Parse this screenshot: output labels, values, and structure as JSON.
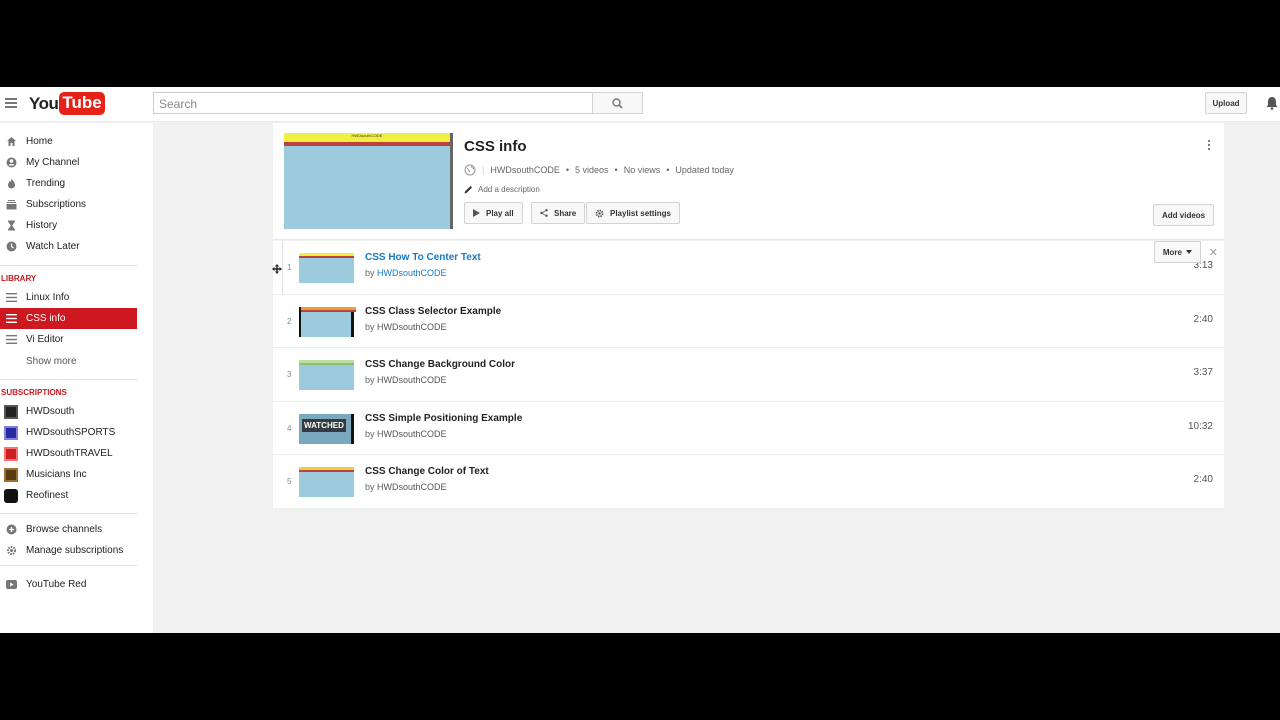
{
  "masthead": {
    "logo_you": "You",
    "logo_tube": "Tube",
    "search_placeholder": "Search",
    "upload_label": "Upload"
  },
  "sidebar": {
    "main_items": [
      {
        "label": "Home",
        "icon": "home-icon"
      },
      {
        "label": "My Channel",
        "icon": "person-icon"
      },
      {
        "label": "Trending",
        "icon": "flame-icon"
      },
      {
        "label": "Subscriptions",
        "icon": "subscriptions-icon"
      },
      {
        "label": "History",
        "icon": "hourglass-icon"
      },
      {
        "label": "Watch Later",
        "icon": "clock-icon"
      }
    ],
    "library_heading": "LIBRARY",
    "library_items": [
      {
        "label": "Linux Info",
        "active": false
      },
      {
        "label": "CSS info",
        "active": true
      },
      {
        "label": "Vi Editor",
        "active": false
      }
    ],
    "show_more": "Show more",
    "subscriptions_heading": "SUBSCRIPTIONS",
    "subscriptions": [
      {
        "label": "HWDsouth",
        "color": "#222222"
      },
      {
        "label": "HWDsouthSPORTS",
        "color": "#2a2aa0"
      },
      {
        "label": "HWDsouthTRAVEL",
        "color": "#cc2020"
      },
      {
        "label": "Musicians Inc",
        "color": "#5a3a10"
      },
      {
        "label": "Reofinest",
        "color": "#111111"
      }
    ],
    "browse_channels": "Browse channels",
    "manage_subscriptions": "Manage subscriptions",
    "youtube_red": "YouTube Red"
  },
  "playlist": {
    "title": "CSS info",
    "thumb_caption": "HWDsouthCODE",
    "owner": "HWDsouthCODE",
    "video_count": "5 videos",
    "views": "No views",
    "updated": "Updated today",
    "add_description": "Add a description",
    "play_all": "Play all",
    "share": "Share",
    "settings": "Playlist settings",
    "add_videos": "Add videos",
    "more": "More",
    "close": "✕"
  },
  "videos": [
    {
      "num": "1",
      "title": "CSS How To Center Text",
      "by": "by",
      "channel": "HWDsouthCODE",
      "duration": "3:13"
    },
    {
      "num": "2",
      "title": "CSS Class Selector Example",
      "by": "by",
      "channel": "HWDsouthCODE",
      "duration": "2:40"
    },
    {
      "num": "3",
      "title": "CSS Change Background Color",
      "by": "by",
      "channel": "HWDsouthCODE",
      "duration": "3:37"
    },
    {
      "num": "4",
      "title": "CSS Simple Positioning Example",
      "by": "by",
      "channel": "HWDsouthCODE",
      "duration": "10:32",
      "badge": "WATCHED"
    },
    {
      "num": "5",
      "title": "CSS Change Color of Text",
      "by": "by",
      "channel": "HWDsouthCODE",
      "duration": "2:40"
    }
  ],
  "colors": {
    "brand_red": "#cc181e",
    "link_blue": "#167ac6"
  }
}
